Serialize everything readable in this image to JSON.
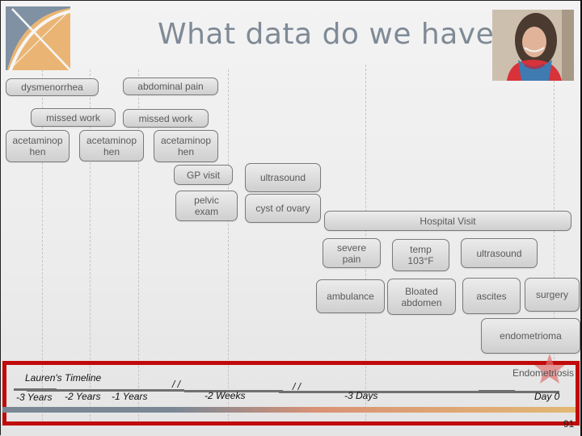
{
  "slide": {
    "title": "What data do we have?",
    "page_number": "91",
    "logo_icon": "crossed-arc-logo",
    "photo_alt": "photo of Lauren"
  },
  "events": {
    "dysmenorrhea": "dysmenorrhea",
    "abdominal_pain": "abdominal pain",
    "missed_work_1": "missed work",
    "missed_work_2": "missed work",
    "acetaminophen_1": "acetaminop\nhen",
    "acetaminophen_2": "acetaminop\nhen",
    "acetaminophen_3": "acetaminop\nhen",
    "gp_visit": "GP visit",
    "ultrasound_1": "ultrasound",
    "pelvic_exam": "pelvic\nexam",
    "cyst_of_ovary": "cyst of ovary",
    "hospital_visit": "Hospital Visit",
    "severe_pain": "severe\npain",
    "temp": "temp\n103°F",
    "ultrasound_2": "ultrasound",
    "ambulance": "ambulance",
    "bloated_abdomen": "Bloated\nabdomen",
    "ascites": "ascites",
    "surgery": "surgery",
    "endometrioma": "endometrioma"
  },
  "timeline": {
    "title": "Lauren's Timeline",
    "ticks": [
      "-3 Years",
      "-2 Years",
      "-1 Years",
      "-2 Weeks",
      "-3 Days",
      "Day 0"
    ],
    "break_mark": "/ /",
    "diagnosis": "Endometriosis",
    "highlight_color": "#c10a0a"
  }
}
